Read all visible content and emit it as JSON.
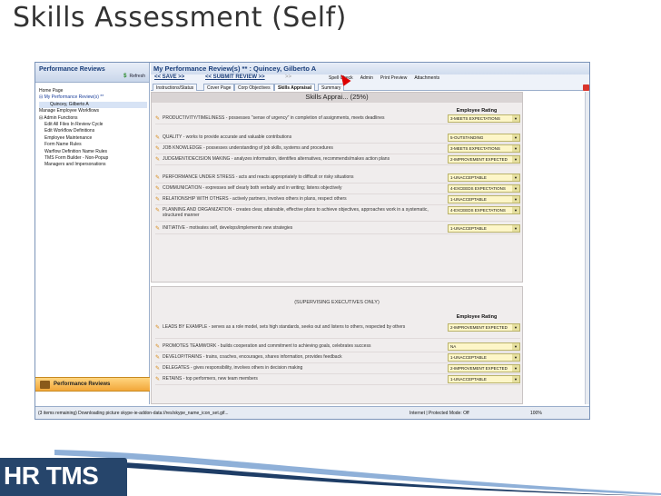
{
  "slide": {
    "title": "Skills Assessment (Self)"
  },
  "logo": {
    "text": "HR TMS"
  },
  "left_pane": {
    "title": "Performance Reviews",
    "refresh_label": "Refresh",
    "tree": [
      {
        "label": "Home Page",
        "indent": 0,
        "prefix": ""
      },
      {
        "label": "My Performance Review(s) **",
        "indent": 0,
        "prefix": "⊟ ",
        "style": "blue"
      },
      {
        "label": "Quincey, Gilberto A",
        "indent": 2,
        "prefix": "",
        "style": "sel"
      },
      {
        "label": "Manage Employee Workflows",
        "indent": 0,
        "prefix": ""
      },
      {
        "label": "Admin Functions",
        "indent": 0,
        "prefix": "⊟ "
      },
      {
        "label": "Edit All Files In Review Cycle",
        "indent": 1,
        "prefix": ""
      },
      {
        "label": "Edit Workflow Definitions",
        "indent": 1,
        "prefix": ""
      },
      {
        "label": "Employee Maintenance",
        "indent": 1,
        "prefix": ""
      },
      {
        "label": "Form Name Rules",
        "indent": 1,
        "prefix": ""
      },
      {
        "label": "Warflow Definition Name Rules",
        "indent": 1,
        "prefix": ""
      },
      {
        "label": "TMS Form Builder - Non-Popup",
        "indent": 1,
        "prefix": ""
      },
      {
        "label": "Managers and Impersonations",
        "indent": 1,
        "prefix": ""
      }
    ],
    "footer_label": "Performance Reviews"
  },
  "right_pane": {
    "title": "My Performance Review(s) ** : Quincey, Gilberto A",
    "save_label": "<< SAVE >>",
    "submit_label": "<< SUBMIT REVIEW >>",
    "sep_label": ">>",
    "tools": [
      "Spell Check",
      "Admin",
      "Print Preview",
      "Attachments"
    ],
    "tabs": [
      "Instructions/Status",
      "Cover Page",
      "Corp Objectives",
      "Skills Appraisal",
      "Summary"
    ],
    "active_tab": "Skills Appraisal"
  },
  "section1": {
    "title": "Skills Apprai... (25%)",
    "col_header": "Employee Rating",
    "rows": [
      {
        "text": "PRODUCTIVITY/TIMELINESS - possesses \"sense of urgency\" in completion of assignments, meets deadlines",
        "rating": "3-MEETS EXPECTATIONS"
      },
      {
        "text": "QUALITY - works to provide accurate and valuable contributions",
        "rating": "5-OUTSTANDING"
      },
      {
        "text": "JOB KNOWLEDGE - possesses understanding of job skills, systems and procedures",
        "rating": "3-MEETS EXPECTATIONS"
      },
      {
        "text": "JUDGMENT/DECISION MAKING - analyzes information, identifies alternatives, recommends/makes action plans",
        "rating": "2-IMPROVEMENT EXPECTED"
      },
      {
        "text": "PERFORMANCE UNDER STRESS - acts and reacts appropriately to difficult or risky situations",
        "rating": "1-UNACCEPTABLE"
      },
      {
        "text": "COMMUNICATION - expresses self clearly both verbally and in writing; listens objectively",
        "rating": "4-EXCEEDS EXPECTATIONS"
      },
      {
        "text": "RELATIONSHIP WITH OTHERS - actively partners, involves others in plans, respect others",
        "rating": "1-UNACCEPTABLE"
      },
      {
        "text": "PLANNING AND ORGANIZATION - creates clear, attainable, effective plans to achieve objectives, approaches work in a systematic, structured manner",
        "rating": "4-EXCEEDS EXPECTATIONS"
      },
      {
        "text": "INITIATIVE - motivates self, develops/implements new strategies",
        "rating": "1-UNACCEPTABLE"
      }
    ]
  },
  "section2": {
    "subtitle": "(SUPERVISING EXECUTIVES ONLY)",
    "col_header": "Employee Rating",
    "rows": [
      {
        "text": "LEADS BY EXAMPLE - serves as a role model, sets high standards, seeks out and listens to others, respected by others",
        "rating": "2-IMPROVEMENT EXPECTED"
      },
      {
        "text": "PROMOTES TEAMWORK - builds cooperation and commitment to achieving goals, celebrates success",
        "rating": "NA"
      },
      {
        "text": "DEVELOP/TRAINS - trains, coaches, encourages, shares information, provides feedback",
        "rating": "1-UNACCEPTABLE"
      },
      {
        "text": "DELEGATES - gives responsibility, involves others in decision making",
        "rating": "2-IMPROVEMENT EXPECTED"
      },
      {
        "text": "RETAINS - top performers, new team members",
        "rating": "1-UNACCEPTABLE"
      }
    ]
  },
  "status_bar": {
    "text": "(3 items remaining) Downloading picture skype-ie-addon-data://res/skype_name_icon_set.gif...",
    "zone": "Internet | Protected Mode: Off",
    "zoom": "100%"
  },
  "colors": {
    "accent": "#1a3e7a",
    "rating_bg": "#fdf6c8",
    "logo_bg": "#26456b",
    "footer": "#f2a73a"
  }
}
